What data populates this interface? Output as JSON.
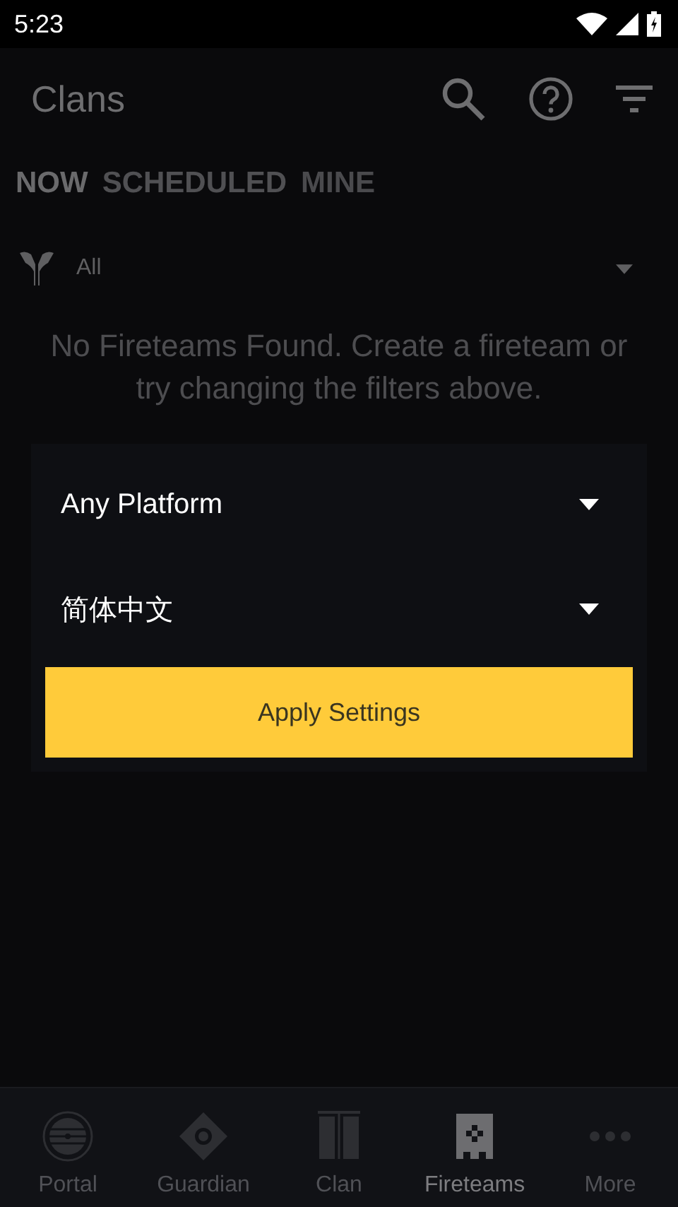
{
  "status_bar": {
    "time": "5:23"
  },
  "header": {
    "title": "Clans"
  },
  "tabs": [
    {
      "label": "NOW",
      "selected": true
    },
    {
      "label": "SCHEDULED",
      "selected": false
    },
    {
      "label": "MINE",
      "selected": false
    }
  ],
  "filter": {
    "value": "All"
  },
  "empty_message": "No Fireteams Found. Create a fireteam or try changing the filters above.",
  "settings_card": {
    "dropdowns": [
      {
        "value": "Any Platform"
      },
      {
        "value": "简体中文"
      }
    ],
    "apply_button": "Apply Settings"
  },
  "bottom_nav": [
    {
      "label": "Portal",
      "selected": false
    },
    {
      "label": "Guardian",
      "selected": false
    },
    {
      "label": "Clan",
      "selected": false
    },
    {
      "label": "Fireteams",
      "selected": true
    },
    {
      "label": "More",
      "selected": false
    }
  ]
}
